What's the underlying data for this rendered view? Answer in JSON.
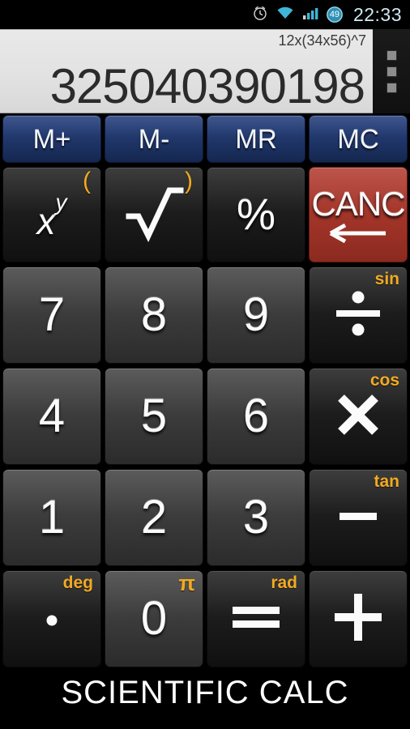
{
  "status_bar": {
    "time": "22:33",
    "battery_level": "49",
    "icons": [
      "alarm-clock-icon",
      "wifi-icon",
      "cellular-signal-icon",
      "battery-icon"
    ]
  },
  "display": {
    "expression": "12x(34x56)^7",
    "result": "325040390198",
    "overflow_menu_label": "overflow-menu"
  },
  "memory_row": [
    {
      "label": "M+",
      "name": "memory-add-button"
    },
    {
      "label": "M-",
      "name": "memory-subtract-button"
    },
    {
      "label": "MR",
      "name": "memory-recall-button"
    },
    {
      "label": "MC",
      "name": "memory-clear-button"
    }
  ],
  "function_row": [
    {
      "label": "x",
      "sup": "y",
      "alt": "(",
      "name": "power-button"
    },
    {
      "label": "√",
      "alt": ")",
      "name": "square-root-button"
    },
    {
      "label": "%",
      "alt": "",
      "name": "percent-button"
    },
    {
      "label": "CANC",
      "alt": "",
      "name": "cancel-button"
    }
  ],
  "keys": {
    "seven": "7",
    "eight": "8",
    "nine": "9",
    "divide": "÷",
    "divide_alt": "sin",
    "four": "4",
    "five": "5",
    "six": "6",
    "multiply": "×",
    "multiply_alt": "cos",
    "one": "1",
    "two": "2",
    "three": "3",
    "minus": "-",
    "minus_alt": "tan",
    "decimal": ".",
    "decimal_alt": "deg",
    "zero": "0",
    "zero_alt": "π",
    "equals": "=",
    "equals_alt": "rad",
    "plus": "+"
  },
  "footer": {
    "brand": "SCIENTIFIC CALC"
  },
  "colors": {
    "memory_blue": "#21386d",
    "cancel_red": "#a33529",
    "alt_label_orange": "#f0a412",
    "display_bg": "#e2e2e2",
    "digit_key": "#3d3d3d",
    "function_key": "#1d1d1d"
  }
}
